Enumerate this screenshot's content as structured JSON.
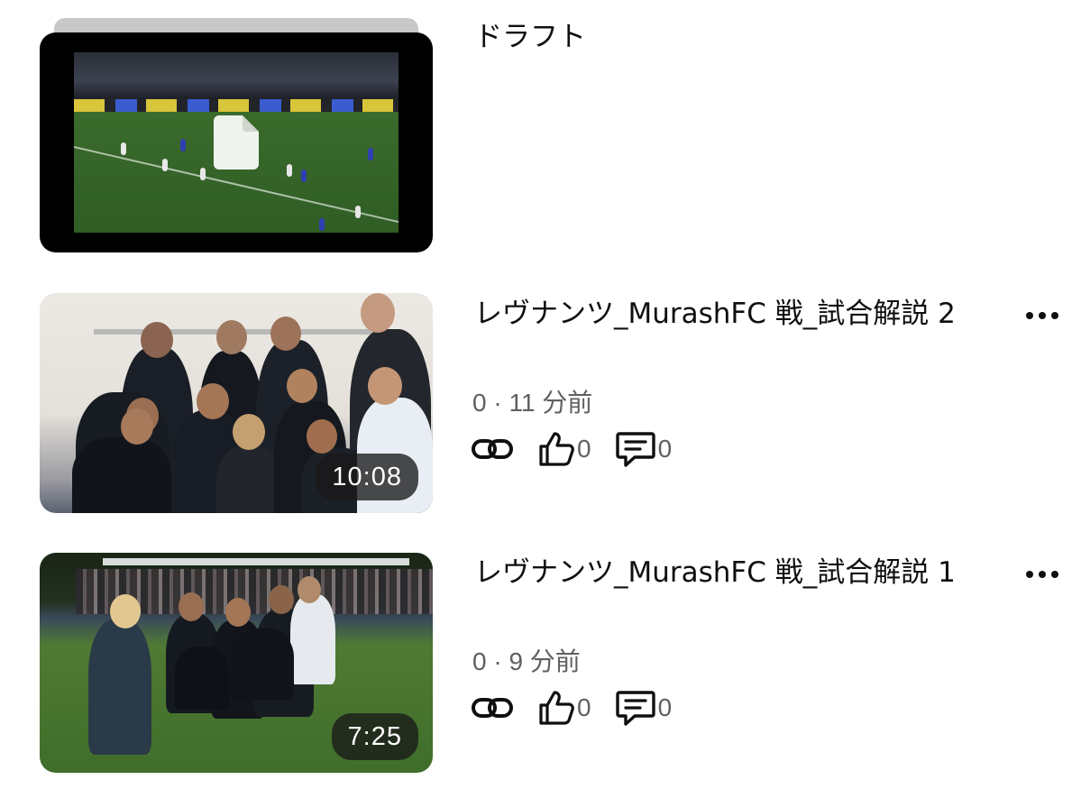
{
  "draft": {
    "title": "ドラフト",
    "thumbnail_icon": "document-icon"
  },
  "videos": [
    {
      "title": "レヴナンツ_MurashFC 戦_試合解説 2",
      "duration": "10:08",
      "meta": "0 · 11 分前",
      "likes": "0",
      "comments": "0"
    },
    {
      "title": "レヴナンツ_MurashFC 戦_試合解説 1",
      "duration": "7:25",
      "meta": "0 · 9 分前",
      "likes": "0",
      "comments": "0"
    }
  ],
  "icons": {
    "link": "link-icon",
    "like": "thumbs-up-icon",
    "comment": "comment-icon",
    "more": "more-options-icon"
  },
  "colors": {
    "text_primary": "#0f0f0f",
    "text_secondary": "#606060",
    "duration_badge": "#191919"
  }
}
